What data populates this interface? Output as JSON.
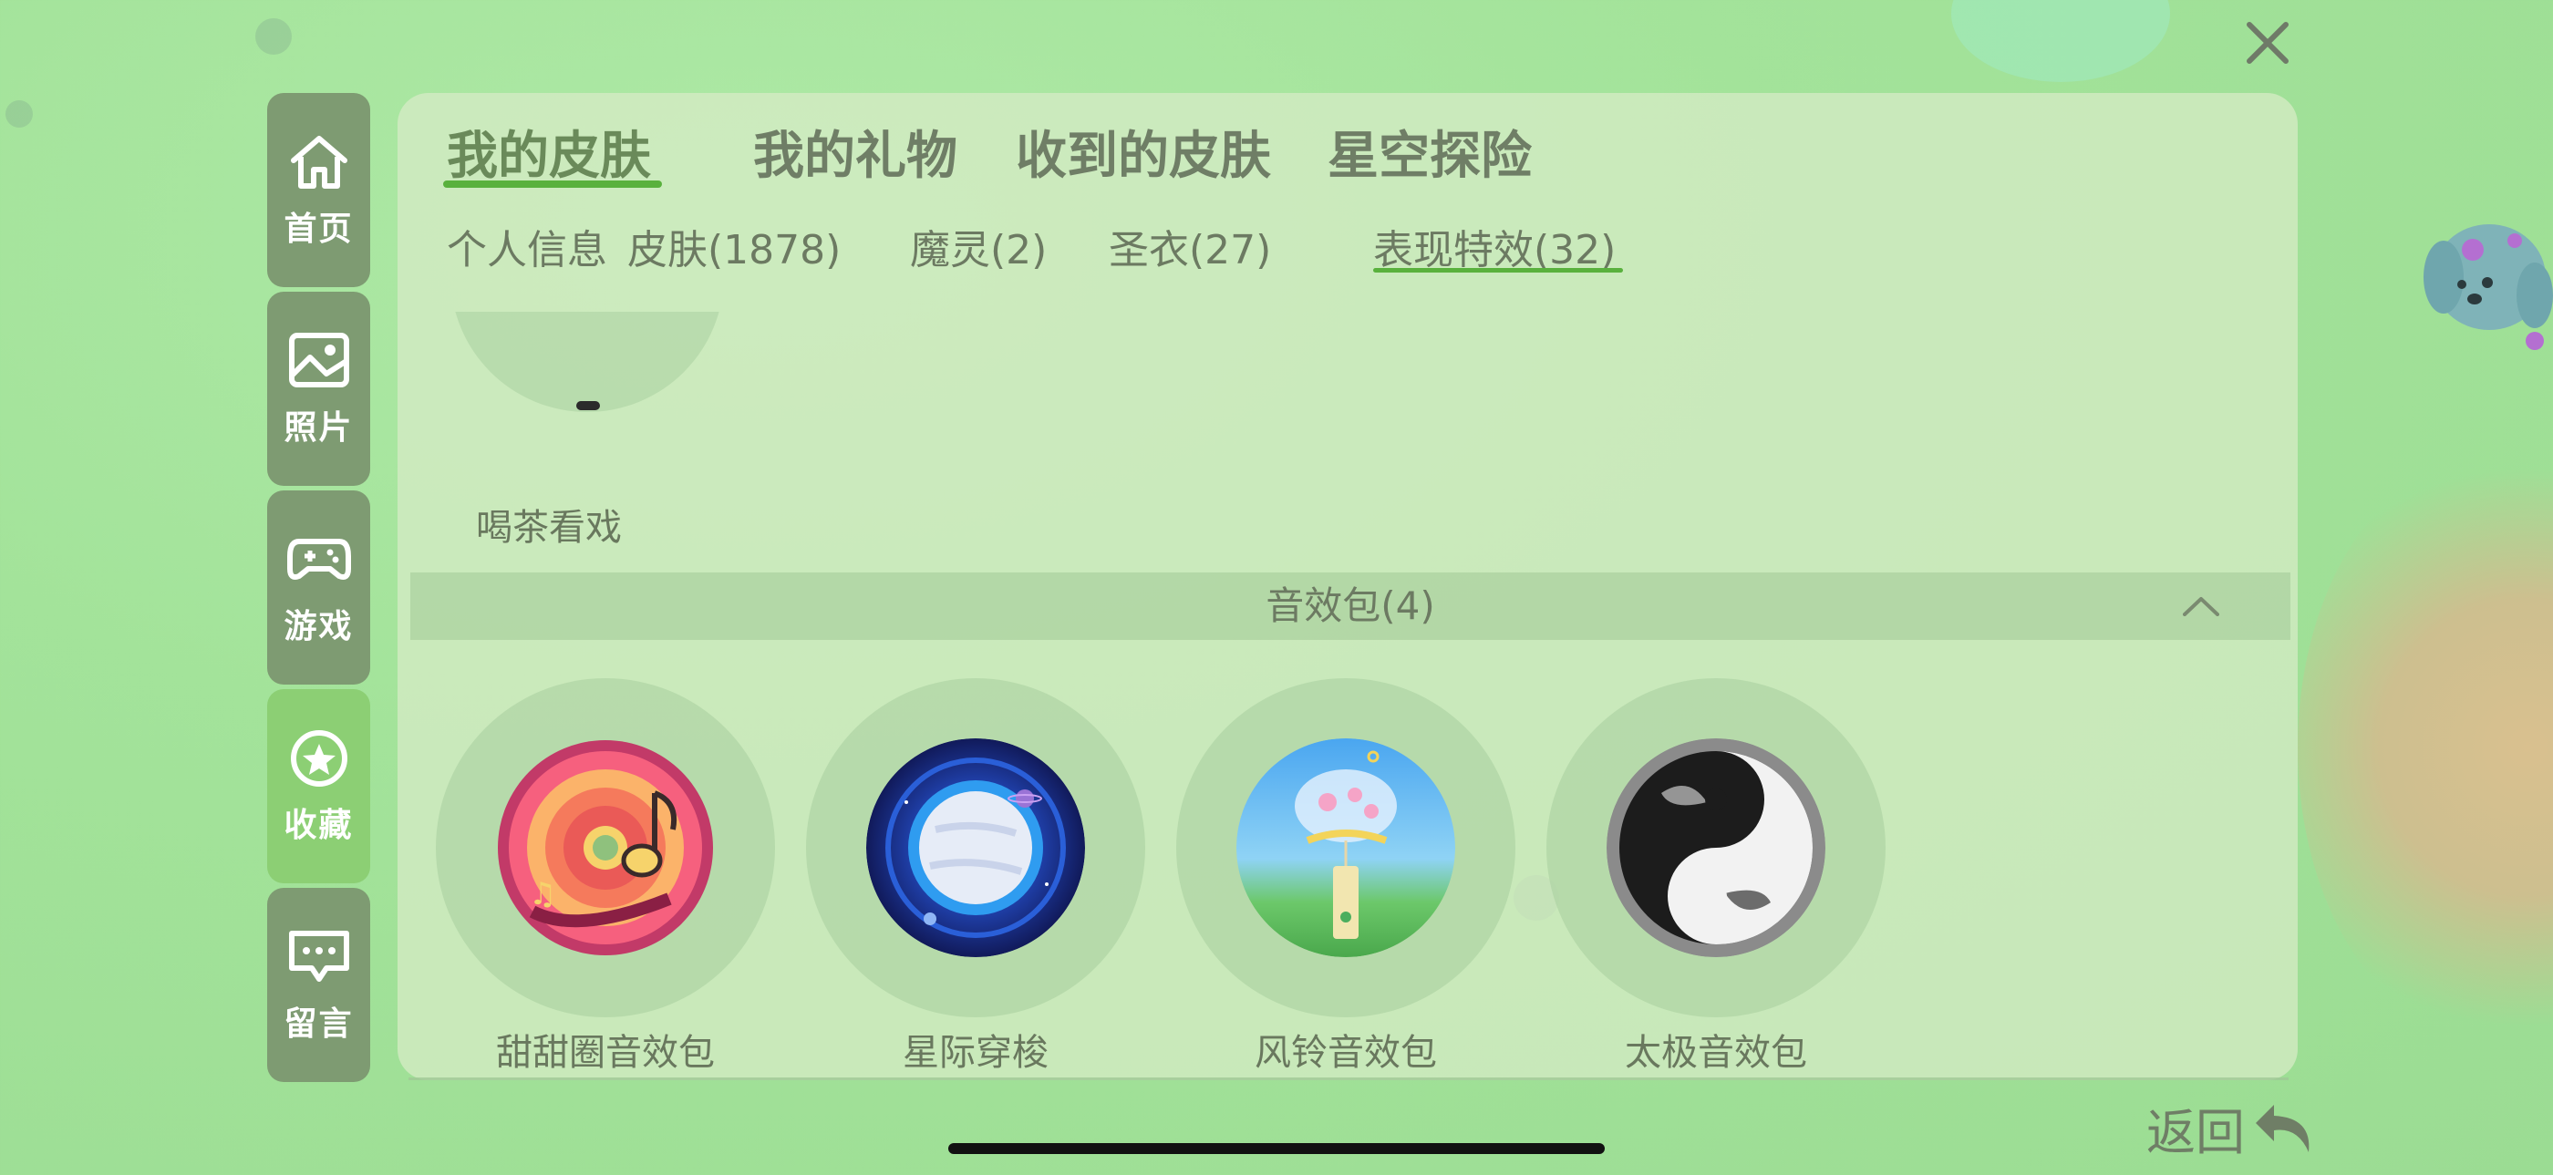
{
  "tabs": [
    "我的皮肤",
    "我的礼物",
    "收到的皮肤",
    "星空探险"
  ],
  "subtabs": [
    "个人信息",
    "皮肤(1878)",
    "魔灵(2)",
    "圣衣(27)",
    "表现特效(32)"
  ],
  "sidebar": {
    "items": [
      {
        "label": "首页",
        "icon": "home-icon"
      },
      {
        "label": "照片",
        "icon": "image-icon"
      },
      {
        "label": "游戏",
        "icon": "gamepad-icon"
      },
      {
        "label": "收藏",
        "icon": "star-icon",
        "active": true
      },
      {
        "label": "留言",
        "icon": "message-icon"
      }
    ]
  },
  "partial_item": {
    "label": "喝茶看戏"
  },
  "section": {
    "title": "音效包(4)"
  },
  "sound_packs": [
    {
      "label": "甜甜圈音效包",
      "icon": "donut-music-icon"
    },
    {
      "label": "星际穿梭",
      "icon": "planet-icon"
    },
    {
      "label": "风铃音效包",
      "icon": "wind-chime-icon"
    },
    {
      "label": "太极音效包",
      "icon": "taiji-icon"
    }
  ],
  "back": {
    "label": "返回"
  },
  "colors": {
    "accent": "#59b13d",
    "sidebar": "#7e9b72",
    "sidebar_active": "#8ccf74"
  }
}
